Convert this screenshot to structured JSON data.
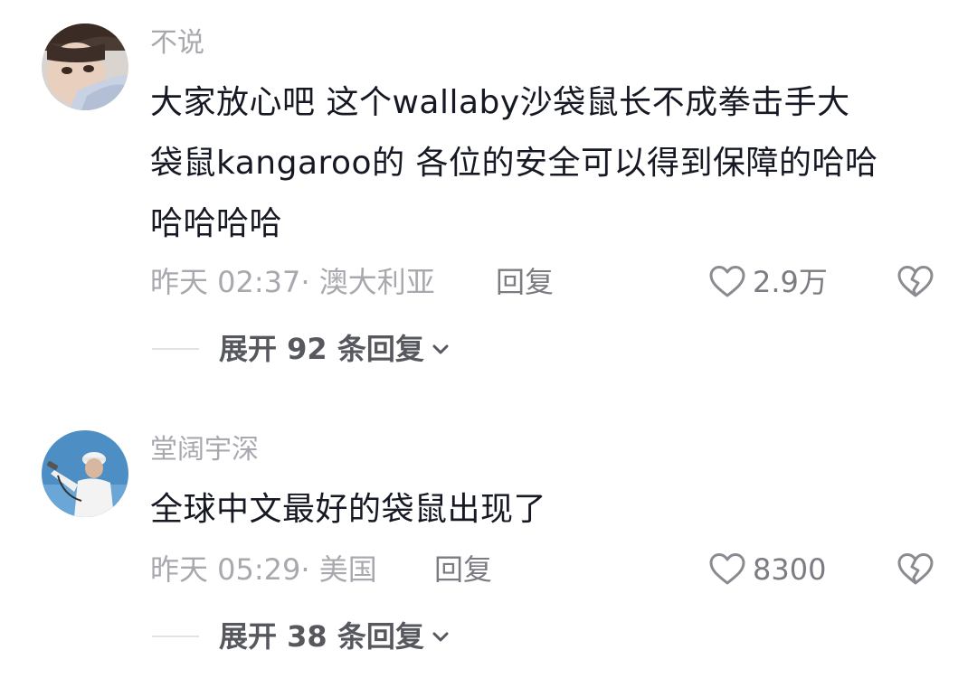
{
  "comments": [
    {
      "username": "不说",
      "lines": [
        "大家放心吧 这个wallaby沙袋鼠长不成拳击手大",
        "袋鼠kangaroo的 各位的安全可以得到保障的哈哈",
        "哈哈哈哈"
      ],
      "time": "昨天 02:37· 澳大利亚",
      "reply_label": "回复",
      "likes": "2.9万",
      "expand_label": "展开 92 条回复",
      "avatar_icon": "user-avatar-girl"
    },
    {
      "username": "堂阔宇深",
      "lines": [
        "全球中文最好的袋鼠出现了"
      ],
      "time": "昨天 05:29· 美国",
      "reply_label": "回复",
      "likes": "8300",
      "expand_label": "展开 38 条回复",
      "avatar_icon": "user-avatar-worker"
    }
  ],
  "icons": {
    "like": "heart-outline-icon",
    "dislike": "broken-heart-icon",
    "expand": "chevron-down-icon"
  },
  "colors": {
    "text": "#161823",
    "secondary": "#a8a9ae",
    "action": "#7b7c82"
  }
}
